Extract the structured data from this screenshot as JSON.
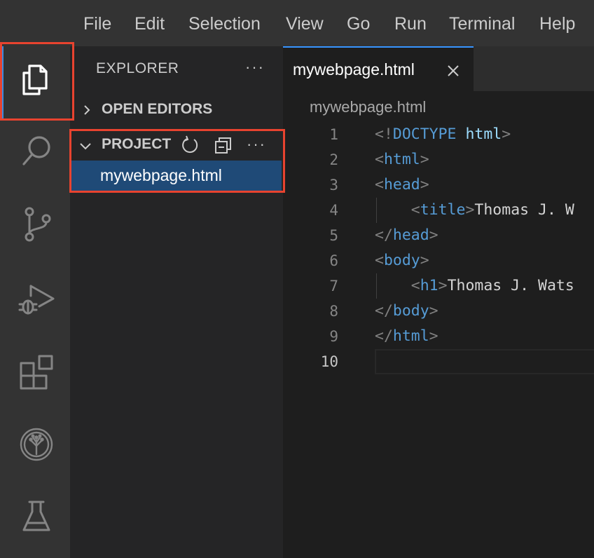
{
  "menu": {
    "items": [
      "File",
      "Edit",
      "Selection",
      "View",
      "Go",
      "Run",
      "Terminal",
      "Help"
    ]
  },
  "activity_bar": {
    "icons": [
      "explorer-icon",
      "search-icon",
      "source-control-icon",
      "run-debug-icon",
      "extensions-icon",
      "skills-network-icon",
      "lab-flask-icon"
    ],
    "active": "explorer-icon"
  },
  "sidebar": {
    "title": "EXPLORER",
    "more": "···",
    "open_editors": "OPEN EDITORS",
    "project": "PROJECT",
    "project_more": "···",
    "file": "mywebpage.html"
  },
  "editor": {
    "tab_label": "mywebpage.html",
    "breadcrumb": "mywebpage.html",
    "line_numbers": [
      "1",
      "2",
      "3",
      "4",
      "5",
      "6",
      "7",
      "8",
      "9",
      "10"
    ],
    "active_line": "10",
    "code": {
      "l1_open": "<!",
      "l1_kw": "DOCTYPE",
      "l1_attr": " html",
      "l1_close": ">",
      "l2_lt": "<",
      "l2_tag": "html",
      "l2_gt": ">",
      "l3_lt": "<",
      "l3_tag": "head",
      "l3_gt": ">",
      "l4_indent": "    ",
      "l4_lt": "<",
      "l4_tag": "title",
      "l4_gt": ">",
      "l4_text": "Thomas J. W",
      "l5_lt": "</",
      "l5_tag": "head",
      "l5_gt": ">",
      "l6_lt": "<",
      "l6_tag": "body",
      "l6_gt": ">",
      "l7_indent": "    ",
      "l7_lt": "<",
      "l7_tag": "h1",
      "l7_gt": ">",
      "l7_text": "Thomas J. Wats",
      "l8_lt": "</",
      "l8_tag": "body",
      "l8_gt": ">",
      "l9_lt": "</",
      "l9_tag": "html",
      "l9_gt": ">"
    }
  },
  "colors": {
    "highlight_box": "#e8432f",
    "selected_file_bg": "#1f4a77",
    "tag_blue": "#569cd6"
  }
}
